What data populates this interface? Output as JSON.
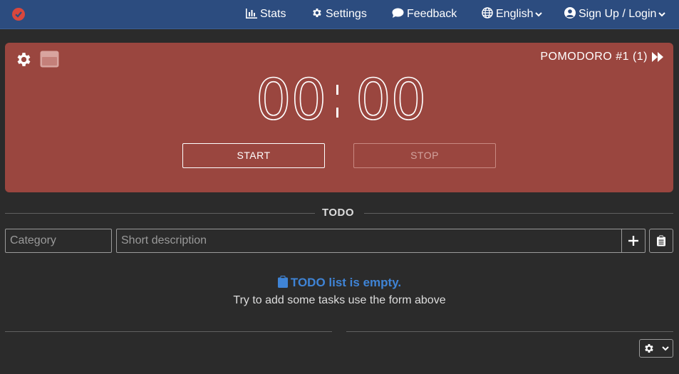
{
  "nav": {
    "stats": "Stats",
    "settings": "Settings",
    "feedback": "Feedback",
    "language": "English",
    "account": "Sign Up / Login"
  },
  "timer": {
    "mode_label": "POMODORO #1 (1)",
    "minutes": "00",
    "seconds": "00",
    "start_label": "START",
    "stop_label": "STOP"
  },
  "todo": {
    "title": "TODO",
    "category_placeholder": "Category",
    "description_placeholder": "Short description",
    "empty_title": "TODO list is empty.",
    "empty_subtitle": "Try to add some tasks use the form above"
  },
  "colors": {
    "navbar": "#2c4c7f",
    "timer_bg": "#9a463f",
    "accent_blue": "#3f84d6",
    "page_bg": "#2b2b2b"
  }
}
